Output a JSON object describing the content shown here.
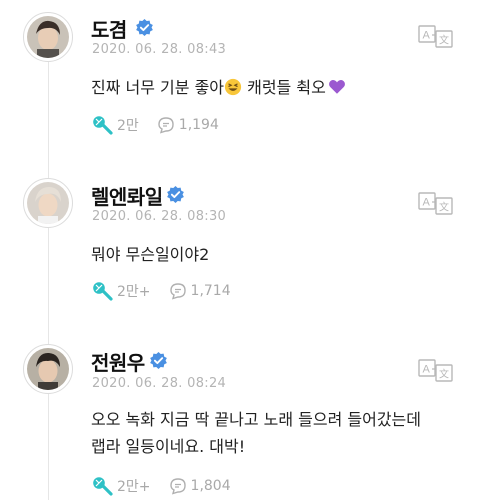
{
  "posts": [
    {
      "author": "도겸",
      "timestamp": "2020. 06. 28. 08:43",
      "text_before_emoji": "진짜 너무 기분 좋아",
      "text_after_emoji": " 캐럿들 췩오",
      "emojis": [
        "grinning-squinting-face",
        "purple-heart"
      ],
      "likes": "2만",
      "comments": "1,194"
    },
    {
      "author": "렐엔롸일",
      "timestamp": "2020. 06. 28. 08:30",
      "text": "뭐야 무슨일이야2",
      "likes": "2만+",
      "comments": "1,714"
    },
    {
      "author": "전원우",
      "timestamp": "2020. 06. 28. 08:24",
      "text_line1": "오오 녹화 지금 딱 끝나고 노래 들으려 들어갔는데",
      "text_line2": "랩라 일등이네요. 대박!",
      "likes": "2만+",
      "comments": "1,804"
    }
  ],
  "colors": {
    "accent": "#2ec1c6",
    "verified": "#4a90e2",
    "meta": "#b4b4b4",
    "heart": "#9b59d0"
  }
}
